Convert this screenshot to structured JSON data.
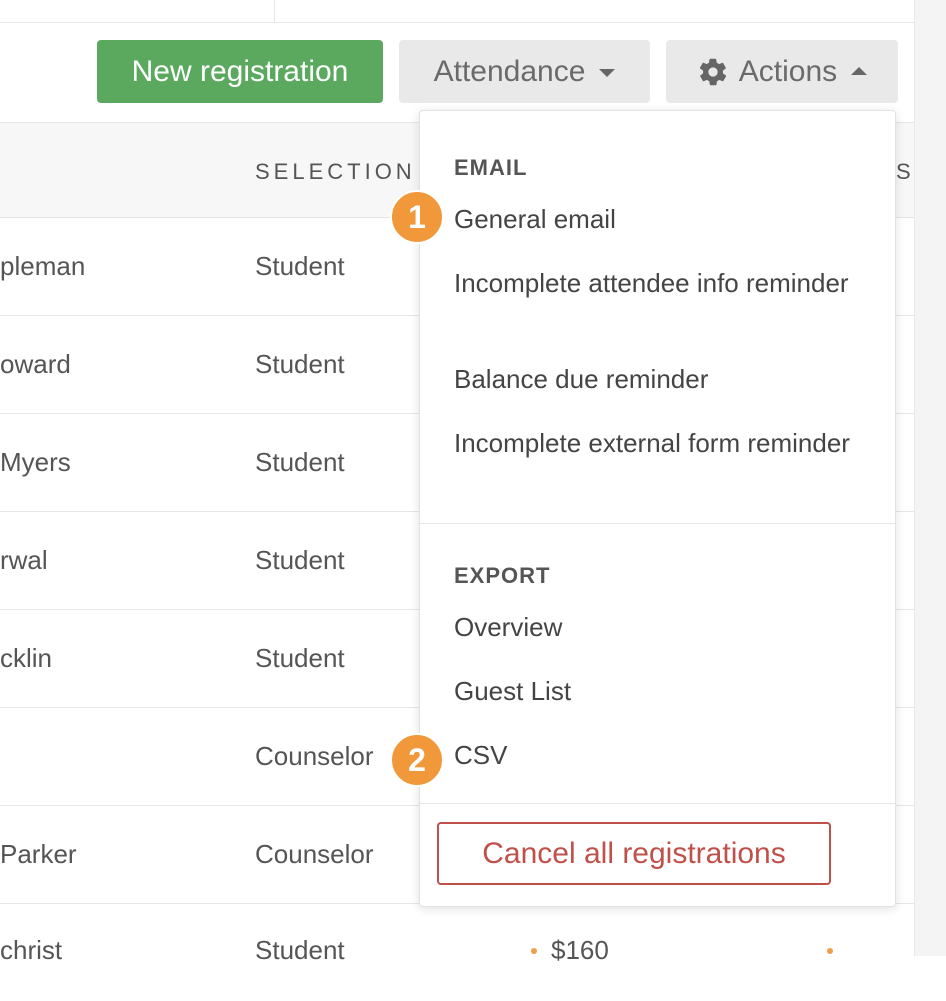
{
  "toolbar": {
    "new_registration": "New registration",
    "attendance": "Attendance",
    "actions": "Actions"
  },
  "table": {
    "header_selection": "SELECTION",
    "header_right": "S",
    "rows": [
      {
        "name": "pleman",
        "selection": "Student",
        "amount": ""
      },
      {
        "name": "oward",
        "selection": "Student",
        "amount": ""
      },
      {
        "name": "Myers",
        "selection": "Student",
        "amount": ""
      },
      {
        "name": "rwal",
        "selection": "Student",
        "amount": ""
      },
      {
        "name": "cklin",
        "selection": "Student",
        "amount": ""
      },
      {
        "name": "",
        "selection": "Counselor",
        "amount": ""
      },
      {
        "name": "Parker",
        "selection": "Counselor",
        "amount": ""
      },
      {
        "name": "christ",
        "selection": "Student",
        "amount": "$160"
      }
    ]
  },
  "menu": {
    "email_heading": "EMAIL",
    "email_items": [
      "General email",
      "Incomplete attendee info reminder",
      "Balance due reminder",
      "Incomplete external form reminder"
    ],
    "export_heading": "EXPORT",
    "export_items": [
      "Overview",
      "Guest List",
      "CSV"
    ],
    "cancel_all": "Cancel all registrations"
  },
  "badges": [
    "1",
    "2"
  ],
  "colors": {
    "primary_green": "#5aa95e",
    "danger_red": "#c0504a",
    "badge_orange": "#f0983a"
  },
  "icons": {
    "actions": "gear-icon",
    "attendance_caret": "caret-down-icon",
    "actions_caret": "caret-up-icon"
  }
}
